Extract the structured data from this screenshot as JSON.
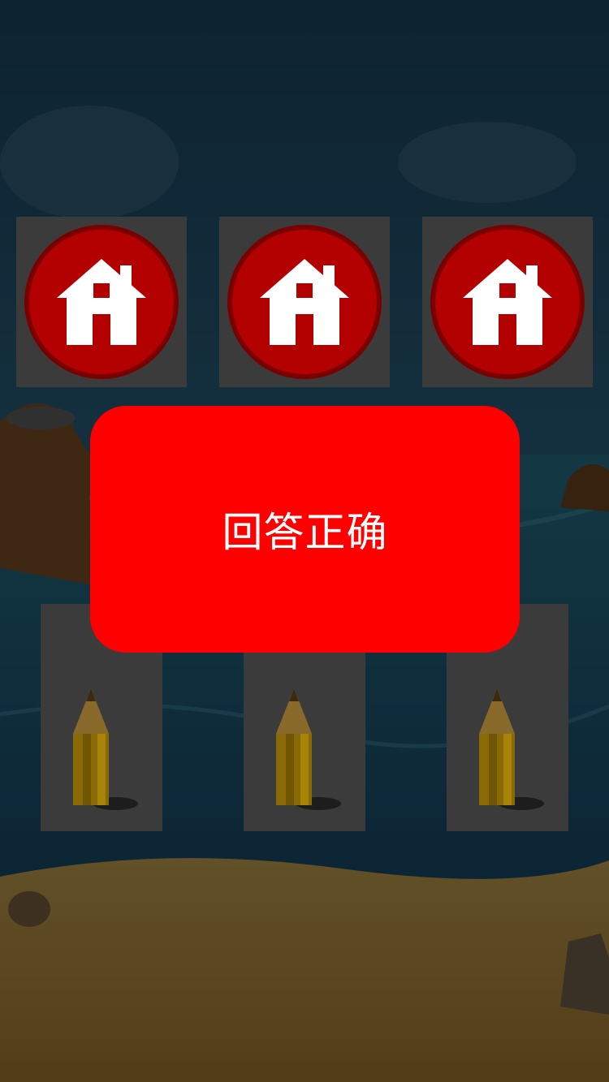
{
  "game": {
    "top_cards": [
      {
        "icon": "home-icon"
      },
      {
        "icon": "home-icon"
      },
      {
        "icon": "home-icon"
      }
    ],
    "bottom_cards": [
      {
        "icon": "pencil-icon"
      },
      {
        "icon": "pencil-icon"
      },
      {
        "icon": "pencil-icon"
      }
    ],
    "result_message": "回答正确",
    "colors": {
      "result_bg": "#ff0000",
      "result_text": "#ffffff",
      "home_button": "#b30000",
      "card_bg": "#3b3b3b"
    }
  }
}
